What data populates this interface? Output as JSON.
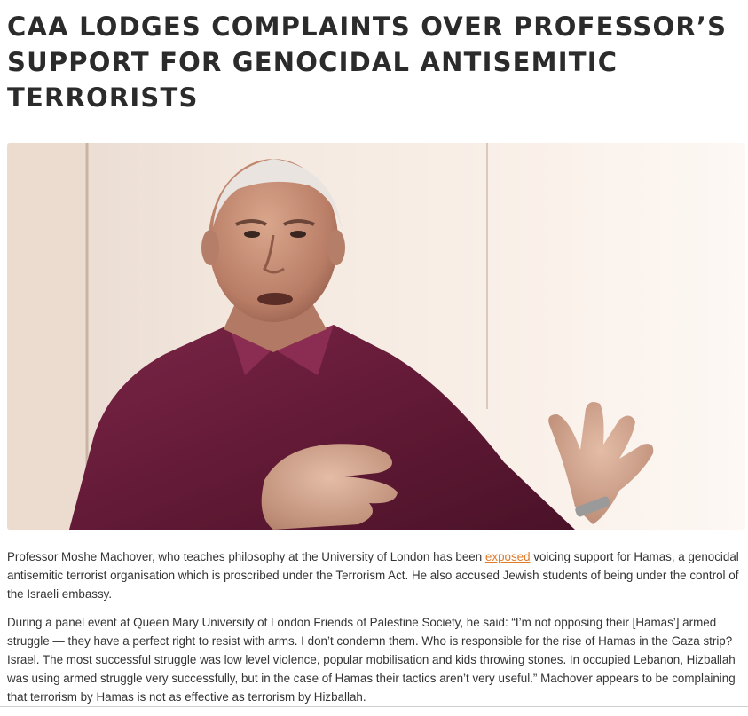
{
  "article": {
    "title": "CAA LODGES COMPLAINTS OVER PROFESSOR’S SUPPORT FOR GENOCIDAL ANTISEMITIC TERRORISTS",
    "paragraphs": [
      {
        "before_link": "Professor Moshe Machover, who teaches philosophy at the University of London has been ",
        "link_text": "exposed",
        "after_link": " voicing support for Hamas, a genocidal antisemitic terrorist organisation which is proscribed under the Terrorism Act. He also accused Jewish students of being under the control of the Israeli embassy."
      },
      {
        "text": "During a panel event at Queen Mary University of London Friends of Palestine Society, he said: “I’m not opposing their [Hamas’] armed struggle — they have a perfect right to resist with arms. I don’t condemn them. Who is responsible for the rise of Hamas in the Gaza strip? Israel. The most successful struggle was low level violence, popular mobilisation and kids throwing stones. In occupied Lebanon, Hizballah was using armed struggle very successfully, but in the case of Hamas their tactics aren’t very useful.” Machover appears to be complaining that terrorism by Hamas is not as effective as terrorism by Hizballah."
      }
    ]
  },
  "colors": {
    "link": "#e07b2a",
    "title": "#2b2b2b",
    "body": "#333333",
    "shirt": "#6e1f3c",
    "wall": "#f3e6dc"
  }
}
